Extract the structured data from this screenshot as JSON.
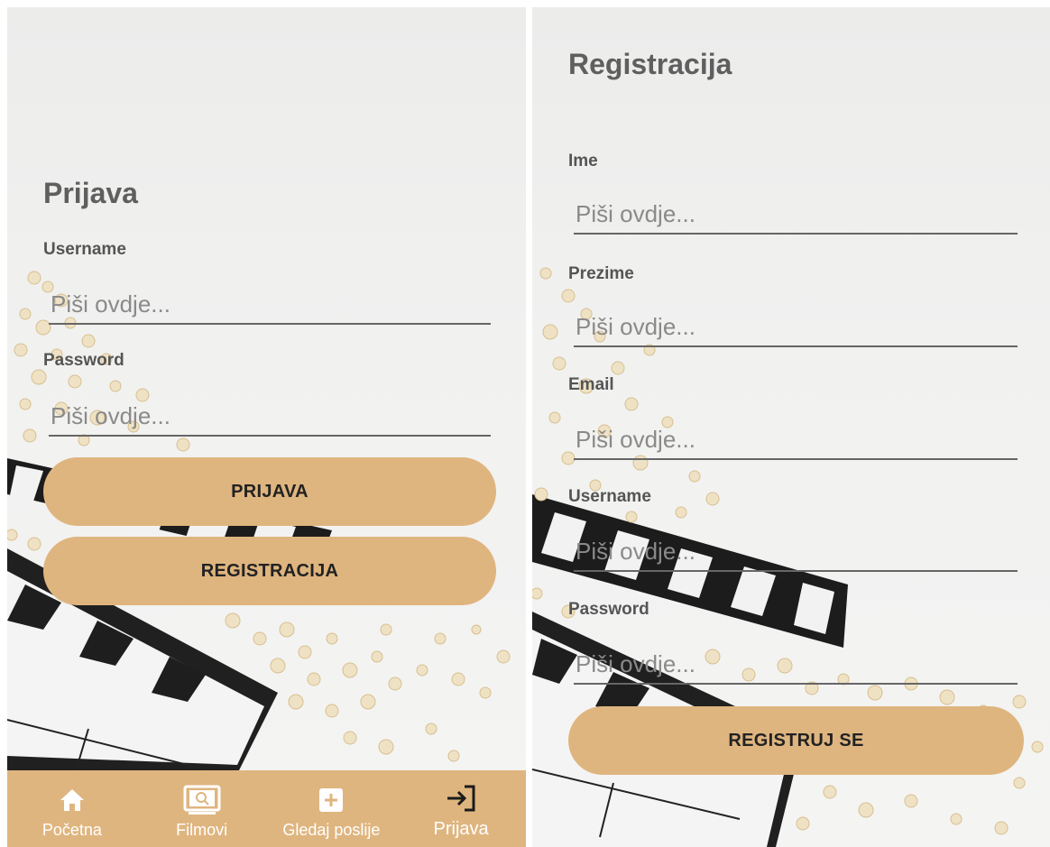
{
  "login": {
    "title": "Prijava",
    "username_label": "Username",
    "username_placeholder": "Piši ovdje...",
    "password_label": "Password",
    "password_placeholder": "Piši ovdje...",
    "login_button": "PRIJAVA",
    "register_button": "REGISTRACIJA"
  },
  "register": {
    "title": "Registracija",
    "first_name_label": "Ime",
    "first_name_placeholder": "Piši ovdje...",
    "last_name_label": "Prezime",
    "last_name_placeholder": "Piši ovdje...",
    "email_label": "Email",
    "email_placeholder": "Piši ovdje...",
    "username_label": "Username",
    "username_placeholder": "Piši ovdje...",
    "password_label": "Password",
    "password_placeholder": "Piši ovdje...",
    "submit_button": "REGISTRUJ SE"
  },
  "bottom_nav": {
    "items": [
      {
        "label": "Početna",
        "icon": "home-icon"
      },
      {
        "label": "Filmovi",
        "icon": "film-screen-icon"
      },
      {
        "label": "Gledaj poslije",
        "icon": "add-box-icon"
      },
      {
        "label": "Prijava",
        "icon": "login-icon",
        "active": true
      }
    ]
  },
  "theme": {
    "accent": "#dfb57f",
    "title_color": "#5f5f5f"
  }
}
